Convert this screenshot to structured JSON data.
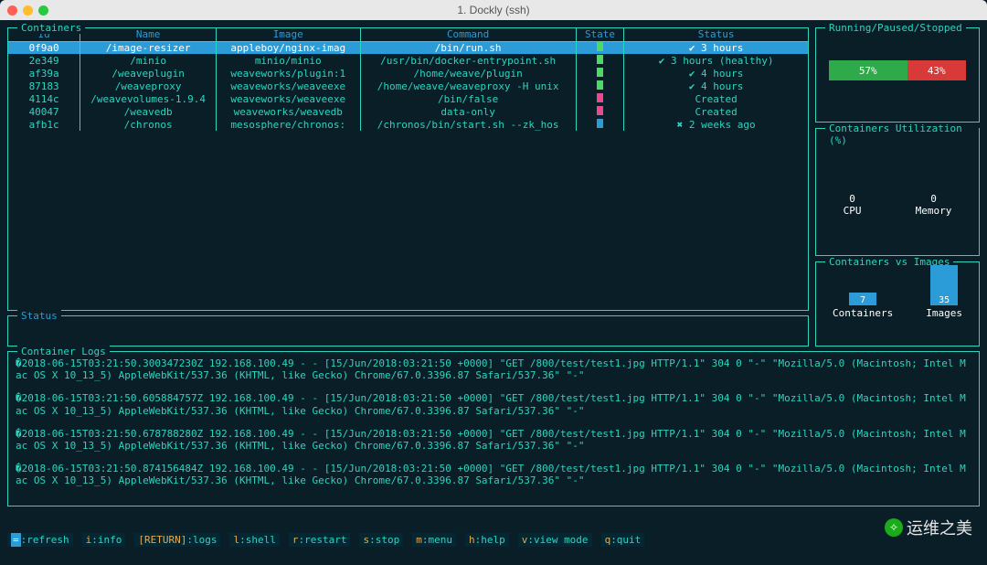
{
  "window": {
    "title": "1. Dockly (ssh)"
  },
  "containers": {
    "title": "Containers",
    "headers": [
      "Id",
      "Name",
      "Image",
      "Command",
      "State",
      "Status"
    ],
    "rows": [
      {
        "id": "0f9a0",
        "name": "/image-resizer",
        "image": "appleboy/nginx-imag",
        "command": "/bin/run.sh",
        "state_color": "#4cd964",
        "status": "✔ 3 hours",
        "selected": true
      },
      {
        "id": "2e349",
        "name": "/minio",
        "image": "minio/minio",
        "command": "/usr/bin/docker-entrypoint.sh",
        "state_color": "#4cd964",
        "status": "✔ 3 hours (healthy)"
      },
      {
        "id": "af39a",
        "name": "/weaveplugin",
        "image": "weaveworks/plugin:1",
        "command": "/home/weave/plugin",
        "state_color": "#4cd964",
        "status": "✔ 4 hours"
      },
      {
        "id": "87183",
        "name": "/weaveproxy",
        "image": "weaveworks/weaveexe",
        "command": "/home/weave/weaveproxy -H unix",
        "state_color": "#4cd964",
        "status": "✔ 4 hours"
      },
      {
        "id": "4114c",
        "name": "/weavevolumes-1.9.4",
        "image": "weaveworks/weaveexe",
        "command": "/bin/false",
        "state_color": "#e84a8f",
        "status": "Created"
      },
      {
        "id": "40047",
        "name": "/weavedb",
        "image": "weaveworks/weavedb",
        "command": "data-only",
        "state_color": "#e84a8f",
        "status": "Created"
      },
      {
        "id": "afb1c",
        "name": "/chronos",
        "image": "mesosphere/chronos:",
        "command": "/chronos/bin/start.sh --zk_hos",
        "state_color": "#2b9cd8",
        "status": "✖ 2 weeks ago"
      }
    ]
  },
  "status": {
    "title": "Status"
  },
  "logs": {
    "title": "Container Logs",
    "lines": [
      "�2018-06-15T03:21:50.300347230Z 192.168.100.49 - - [15/Jun/2018:03:21:50 +0000] \"GET /800/test/test1.jpg HTTP/1.1\" 304 0 \"-\" \"Mozilla/5.0 (Macintosh; Intel Mac OS X 10_13_5) AppleWebKit/537.36 (KHTML, like Gecko) Chrome/67.0.3396.87 Safari/537.36\" \"-\"",
      "�2018-06-15T03:21:50.605884757Z 192.168.100.49 - - [15/Jun/2018:03:21:50 +0000] \"GET /800/test/test1.jpg HTTP/1.1\" 304 0 \"-\" \"Mozilla/5.0 (Macintosh; Intel Mac OS X 10_13_5) AppleWebKit/537.36 (KHTML, like Gecko) Chrome/67.0.3396.87 Safari/537.36\" \"-\"",
      "�2018-06-15T03:21:50.678788280Z 192.168.100.49 - - [15/Jun/2018:03:21:50 +0000] \"GET /800/test/test1.jpg HTTP/1.1\" 304 0 \"-\" \"Mozilla/5.0 (Macintosh; Intel Mac OS X 10_13_5) AppleWebKit/537.36 (KHTML, like Gecko) Chrome/67.0.3396.87 Safari/537.36\" \"-\"",
      "�2018-06-15T03:21:50.874156484Z 192.168.100.49 - - [15/Jun/2018:03:21:50 +0000] \"GET /800/test/test1.jpg HTTP/1.1\" 304 0 \"-\" \"Mozilla/5.0 (Macintosh; Intel Mac OS X 10_13_5) AppleWebKit/537.36 (KHTML, like Gecko) Chrome/67.0.3396.87 Safari/537.36\" \"-\""
    ]
  },
  "rps": {
    "title": "Running/Paused/Stopped",
    "segments": [
      {
        "label": "57%",
        "pct": 57,
        "color": "#2faa4a"
      },
      {
        "label": "43%",
        "pct": 43,
        "color": "#d83a3a"
      }
    ]
  },
  "util": {
    "title": "Containers Utilization (%)",
    "cpu": {
      "value": "0",
      "label": "CPU"
    },
    "mem": {
      "value": "0",
      "label": "Memory"
    }
  },
  "cvi": {
    "title": "Containers vs Images",
    "containers": {
      "value": "7",
      "label": "Containers",
      "height": 14
    },
    "images": {
      "value": "35",
      "label": "Images",
      "height": 44
    }
  },
  "hints": [
    {
      "key": "=",
      "text": ":refresh"
    },
    {
      "key": "i",
      "text": ":info"
    },
    {
      "key": "[RETURN]",
      "text": ":logs"
    },
    {
      "key": "l",
      "text": ":shell"
    },
    {
      "key": "r",
      "text": ":restart"
    },
    {
      "key": "s",
      "text": ":stop"
    },
    {
      "key": "m",
      "text": ":menu"
    },
    {
      "key": "h",
      "text": ":help"
    },
    {
      "key": "v",
      "text": ":view mode"
    },
    {
      "key": "q",
      "text": ":quit"
    }
  ],
  "watermark": "运维之美"
}
